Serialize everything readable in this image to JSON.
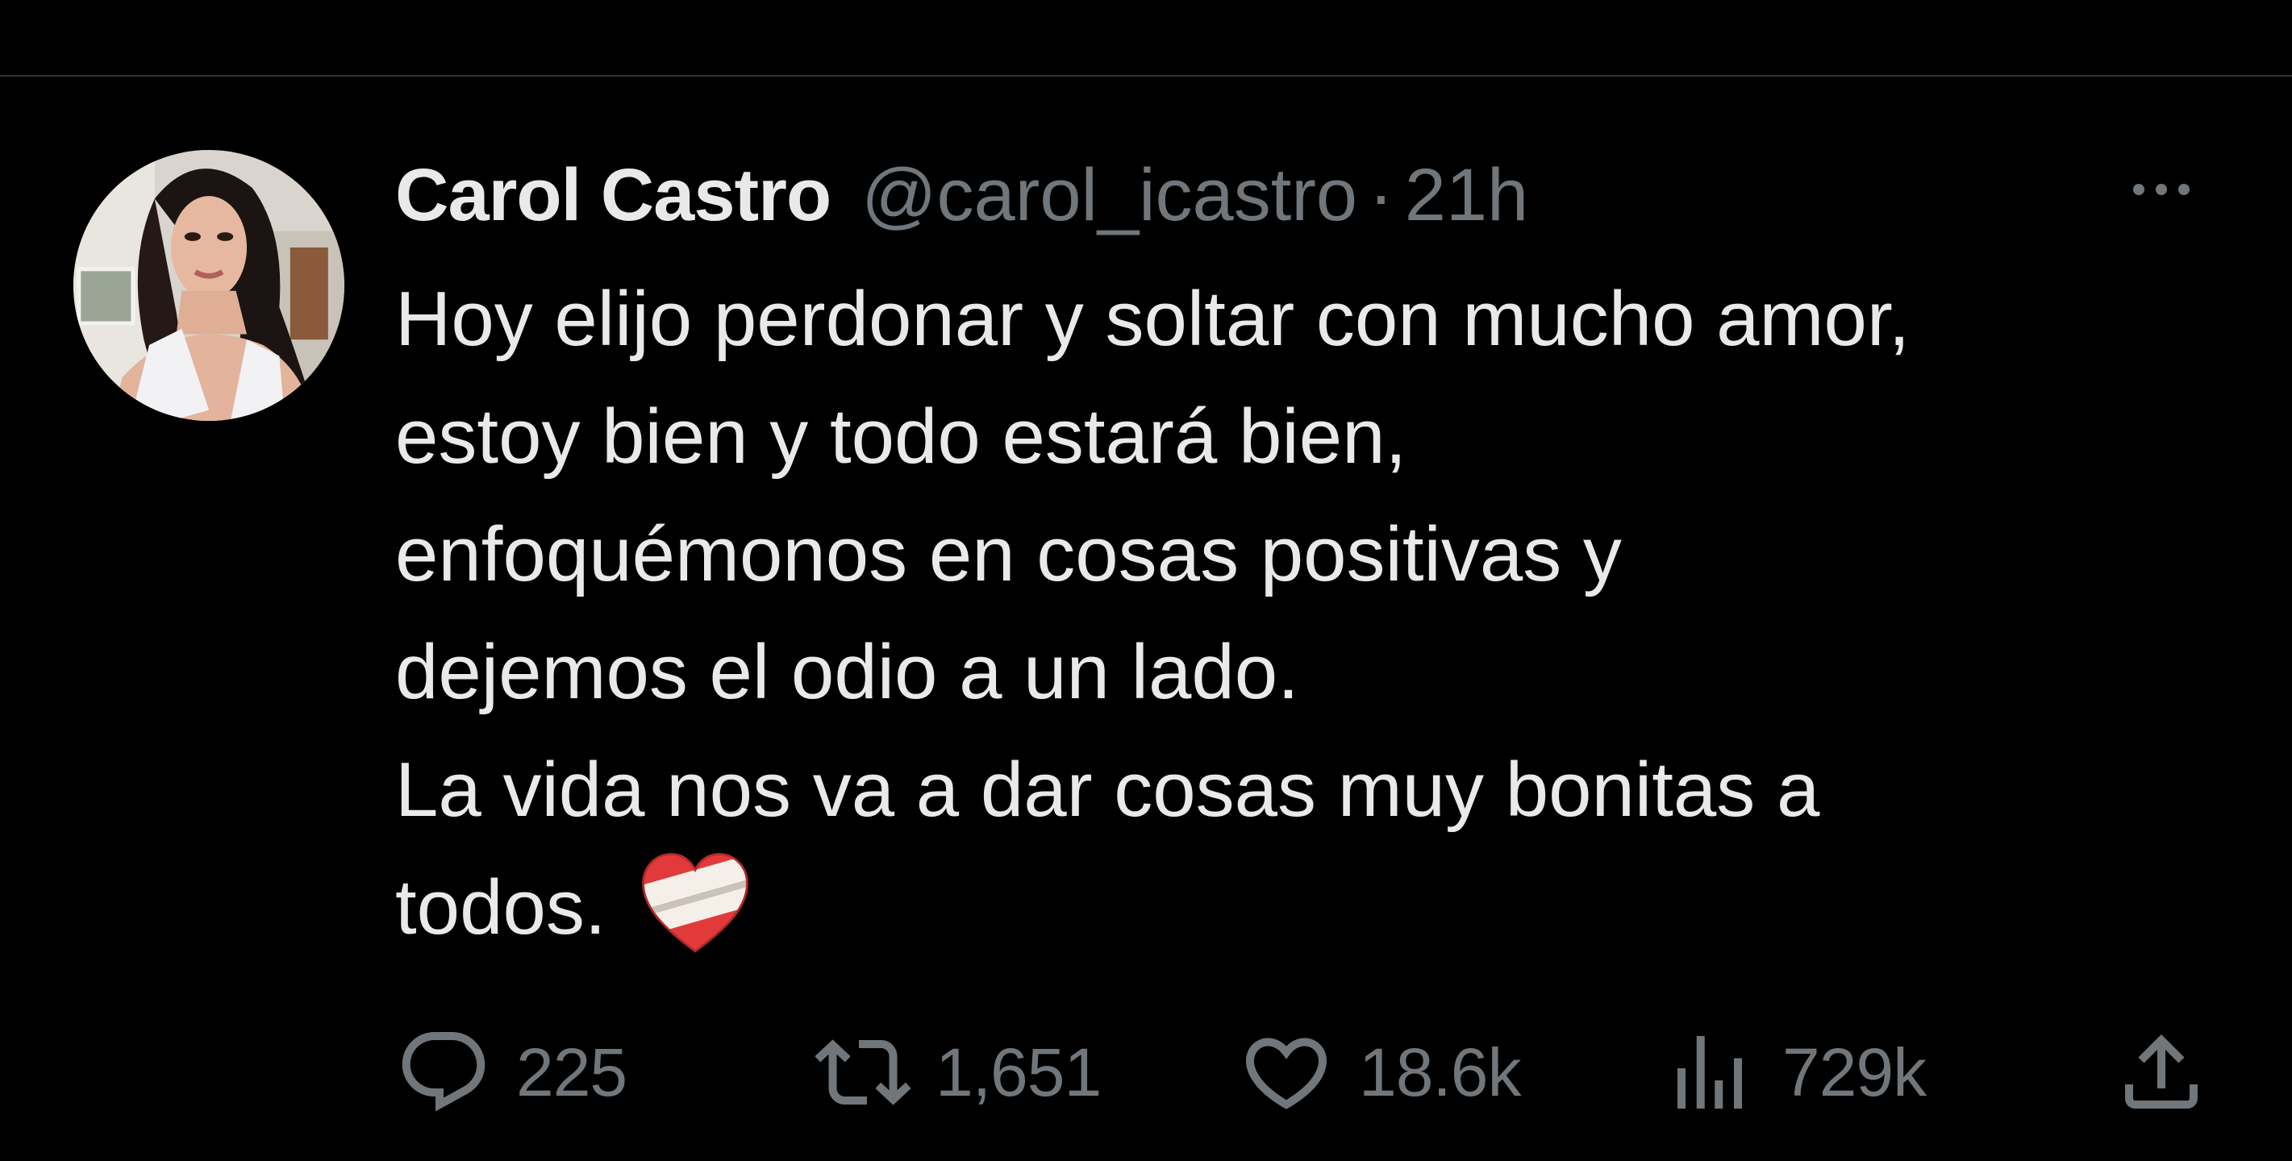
{
  "tweet": {
    "author": {
      "display_name": "Carol Castro",
      "handle": "@carol_icastro",
      "separator": "·",
      "timestamp": "21h"
    },
    "text_lines": [
      "Hoy elijo perdonar y soltar con mucho amor,",
      "estoy bien y todo estará bien,",
      "enfoquémonos en cosas positivas y",
      "dejemos el odio a un lado.",
      "La vida nos va a dar cosas muy bonitas a",
      "todos."
    ],
    "emoji": "mending-heart",
    "actions": {
      "replies": "225",
      "retweets": "1,651",
      "likes": "18.6k",
      "views": "729k"
    }
  },
  "colors": {
    "background": "#000000",
    "text_primary": "#e7e9ea",
    "text_secondary": "#71767b",
    "divider": "#2f3336"
  },
  "icons": {
    "more": "more-icon",
    "reply": "reply-icon",
    "retweet": "retweet-icon",
    "like": "like-icon",
    "views": "views-icon",
    "share": "share-icon"
  }
}
